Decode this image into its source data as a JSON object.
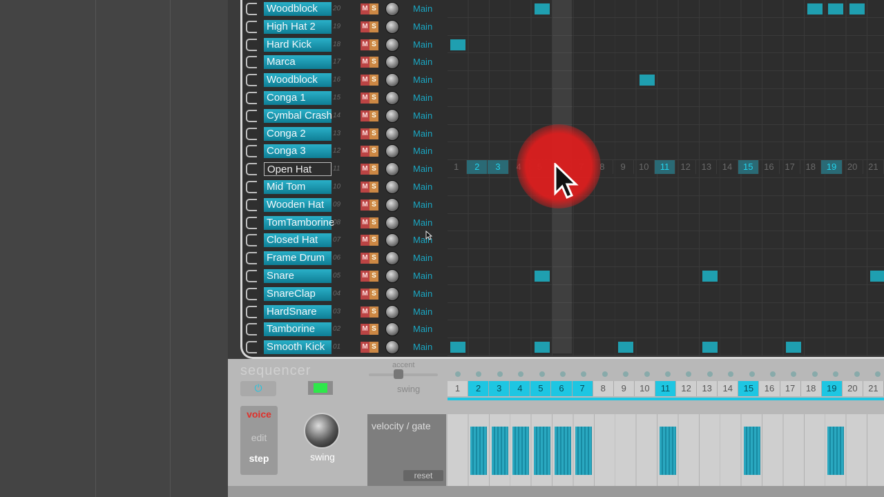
{
  "tracks": [
    {
      "name": "Woodblock",
      "num": "20",
      "out": "Main",
      "steps": [
        5,
        18,
        19,
        20
      ]
    },
    {
      "name": "High Hat 2",
      "num": "19",
      "out": "Main",
      "steps": []
    },
    {
      "name": "Hard Kick",
      "num": "18",
      "out": "Main",
      "steps": [
        1
      ]
    },
    {
      "name": "Marca",
      "num": "17",
      "out": "Main",
      "steps": []
    },
    {
      "name": "Woodblock",
      "num": "16",
      "out": "Main",
      "steps": [
        10
      ]
    },
    {
      "name": "Conga 1",
      "num": "15",
      "out": "Main",
      "steps": []
    },
    {
      "name": "Cymbal Crash",
      "num": "14",
      "out": "Main",
      "steps": []
    },
    {
      "name": "Conga 2",
      "num": "13",
      "out": "Main",
      "steps": []
    },
    {
      "name": "Conga 3",
      "num": "12",
      "out": "Main",
      "steps": []
    },
    {
      "name": "Open Hat",
      "num": "11",
      "out": "Main",
      "steps": [],
      "selected": true
    },
    {
      "name": "Mid Tom",
      "num": "10",
      "out": "Main",
      "steps": []
    },
    {
      "name": "Wooden Hat",
      "num": "09",
      "out": "Main",
      "steps": []
    },
    {
      "name": "TomTamborine",
      "num": "08",
      "out": "Main",
      "steps": []
    },
    {
      "name": "Closed Hat",
      "num": "07",
      "out": "Main",
      "steps": []
    },
    {
      "name": "Frame Drum",
      "num": "06",
      "out": "Main",
      "steps": []
    },
    {
      "name": "Snare",
      "num": "05",
      "out": "Main",
      "steps": [
        5,
        13,
        21
      ]
    },
    {
      "name": "SnareClap",
      "num": "04",
      "out": "Main",
      "steps": []
    },
    {
      "name": "HardSnare",
      "num": "03",
      "out": "Main",
      "steps": []
    },
    {
      "name": "Tamborine",
      "num": "02",
      "out": "Main",
      "steps": []
    },
    {
      "name": "Smooth Kick",
      "num": "01",
      "out": "Main",
      "steps": [
        1,
        5,
        9,
        13,
        17
      ]
    }
  ],
  "open_hat_steps": [
    "1",
    "2",
    "3",
    "4",
    "5",
    "6",
    "7",
    "8",
    "9",
    "10",
    "11",
    "12",
    "13",
    "14",
    "15",
    "16",
    "17",
    "18",
    "19",
    "20",
    "21"
  ],
  "open_hat_on": [
    2,
    3,
    11,
    15,
    19
  ],
  "ms_labels": {
    "m": "M",
    "s": "S"
  },
  "sequencer": {
    "title": "sequencer",
    "accent_label": "accent",
    "swing_label": "swing",
    "step_numbers": [
      "1",
      "2",
      "3",
      "4",
      "5",
      "6",
      "7",
      "8",
      "9",
      "10",
      "11",
      "12",
      "13",
      "14",
      "15",
      "16",
      "17",
      "18",
      "19",
      "20",
      "21"
    ],
    "active_steps": [
      2,
      3,
      4,
      5,
      6,
      7,
      11,
      15,
      19
    ],
    "modes": {
      "voice": "voice",
      "edit": "edit",
      "step": "step"
    },
    "swing_knob_label": "swing",
    "velocity_label": "velocity / gate",
    "reset_label": "reset",
    "velocity_steps": [
      2,
      3,
      4,
      5,
      6,
      7,
      11,
      15,
      19
    ]
  },
  "colors": {
    "accent": "#1ec6e2",
    "step_on": "#1f9fb0",
    "click_ring": "#dc1e1e"
  }
}
